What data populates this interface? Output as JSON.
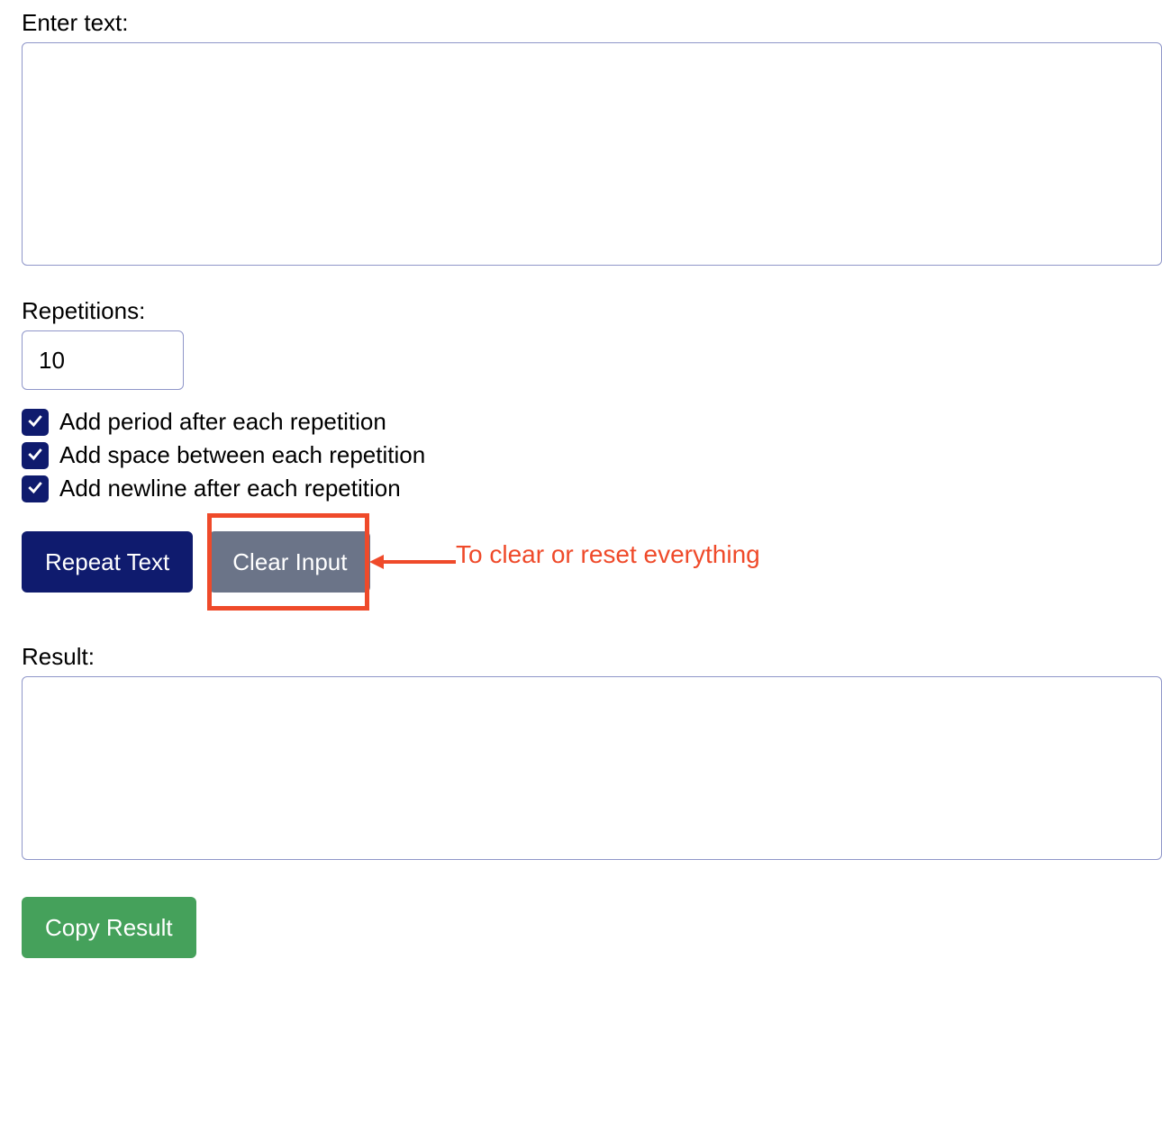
{
  "input": {
    "label": "Enter text:",
    "value": ""
  },
  "repetitions": {
    "label": "Repetitions:",
    "value": "10"
  },
  "options": {
    "period": {
      "checked": true,
      "label": "Add period after each repetition"
    },
    "space": {
      "checked": true,
      "label": "Add space between each repetition"
    },
    "newline": {
      "checked": true,
      "label": "Add newline after each repetition"
    }
  },
  "buttons": {
    "repeat": "Repeat Text",
    "clear": "Clear Input",
    "copy": "Copy Result"
  },
  "result": {
    "label": "Result:",
    "value": ""
  },
  "annotation": {
    "text": "To clear or reset everything"
  }
}
